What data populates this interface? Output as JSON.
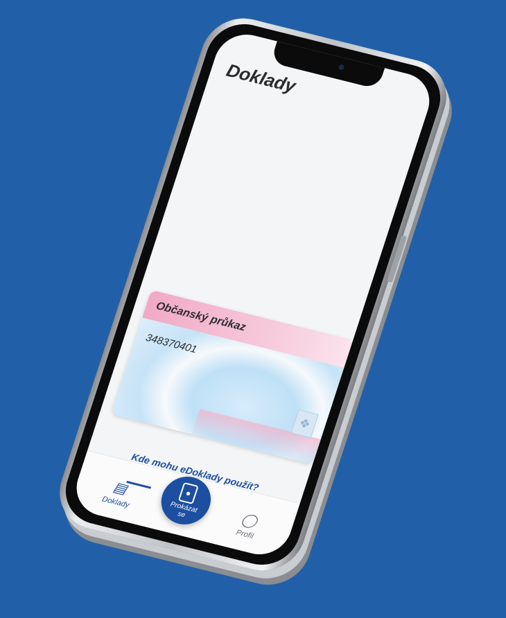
{
  "screen": {
    "title": "Doklady",
    "card": {
      "type": "Občanský průkaz",
      "number": "348370401"
    },
    "help_link": "Kde mohu eDoklady použít?"
  },
  "navbar": {
    "doklady_label": "Doklady",
    "fab_label_line1": "Prokázat",
    "fab_label_line2": "se",
    "profil_label": "Profil",
    "icons": {
      "doklady": "id-card-icon",
      "fab": "phone-id-icon",
      "profil": "person-icon"
    }
  },
  "colors": {
    "background": "#2160a8",
    "accent": "#1c4fa0"
  }
}
